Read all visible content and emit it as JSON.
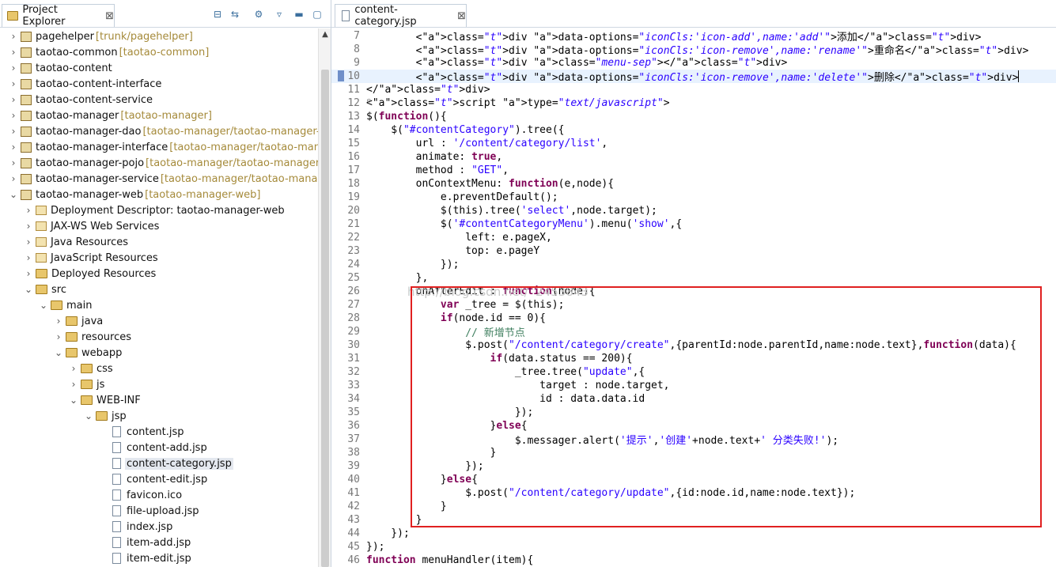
{
  "project_explorer": {
    "title": "Project Explorer",
    "close_glyph": "⊠",
    "toolbar_icons": [
      "collapse-all-icon",
      "link-with-editor-icon",
      "filters-icon",
      "view-menu-icon",
      "minimize-icon",
      "maximize-icon"
    ],
    "items": [
      {
        "label": "pagehelper",
        "decor": " [trunk/pagehelper]",
        "depth": 0,
        "arrow": "›",
        "icon": "project"
      },
      {
        "label": "taotao-common",
        "decor": " [taotao-common]",
        "depth": 0,
        "arrow": "›",
        "icon": "project"
      },
      {
        "label": "taotao-content",
        "decor": "",
        "depth": 0,
        "arrow": "›",
        "icon": "project"
      },
      {
        "label": "taotao-content-interface",
        "decor": "",
        "depth": 0,
        "arrow": "›",
        "icon": "project"
      },
      {
        "label": "taotao-content-service",
        "decor": "",
        "depth": 0,
        "arrow": "›",
        "icon": "project"
      },
      {
        "label": "taotao-manager",
        "decor": " [taotao-manager]",
        "depth": 0,
        "arrow": "›",
        "icon": "project"
      },
      {
        "label": "taotao-manager-dao",
        "decor": " [taotao-manager/taotao-manager-dao",
        "depth": 0,
        "arrow": "›",
        "icon": "project"
      },
      {
        "label": "taotao-manager-interface",
        "decor": " [taotao-manager/taotao-manager",
        "depth": 0,
        "arrow": "›",
        "icon": "project"
      },
      {
        "label": "taotao-manager-pojo",
        "decor": " [taotao-manager/taotao-manager-poj",
        "depth": 0,
        "arrow": "›",
        "icon": "project"
      },
      {
        "label": "taotao-manager-service",
        "decor": " [taotao-manager/taotao-manager-s",
        "depth": 0,
        "arrow": "›",
        "icon": "project"
      },
      {
        "label": "taotao-manager-web",
        "decor": " [taotao-manager-web]",
        "depth": 0,
        "arrow": "⌄",
        "icon": "project"
      },
      {
        "label": "Deployment Descriptor: taotao-manager-web",
        "decor": "",
        "depth": 1,
        "arrow": "›",
        "icon": "pkg"
      },
      {
        "label": "JAX-WS Web Services",
        "decor": "",
        "depth": 1,
        "arrow": "›",
        "icon": "pkg"
      },
      {
        "label": "Java Resources",
        "decor": "",
        "depth": 1,
        "arrow": "›",
        "icon": "pkg"
      },
      {
        "label": "JavaScript Resources",
        "decor": "",
        "depth": 1,
        "arrow": "›",
        "icon": "pkg"
      },
      {
        "label": "Deployed Resources",
        "decor": "",
        "depth": 1,
        "arrow": "›",
        "icon": "folder"
      },
      {
        "label": "src",
        "decor": "",
        "depth": 1,
        "arrow": "⌄",
        "icon": "folder"
      },
      {
        "label": "main",
        "decor": "",
        "depth": 2,
        "arrow": "⌄",
        "icon": "folder"
      },
      {
        "label": "java",
        "decor": "",
        "depth": 3,
        "arrow": "›",
        "icon": "folder"
      },
      {
        "label": "resources",
        "decor": "",
        "depth": 3,
        "arrow": "›",
        "icon": "folder"
      },
      {
        "label": "webapp",
        "decor": "",
        "depth": 3,
        "arrow": "⌄",
        "icon": "folder"
      },
      {
        "label": "css",
        "decor": "",
        "depth": 4,
        "arrow": "›",
        "icon": "folder"
      },
      {
        "label": "js",
        "decor": "",
        "depth": 4,
        "arrow": "›",
        "icon": "folder"
      },
      {
        "label": "WEB-INF",
        "decor": "",
        "depth": 4,
        "arrow": "⌄",
        "icon": "folder"
      },
      {
        "label": "jsp",
        "decor": "",
        "depth": 5,
        "arrow": "⌄",
        "icon": "folder"
      },
      {
        "label": "content.jsp",
        "decor": "",
        "depth": 6,
        "arrow": "",
        "icon": "file"
      },
      {
        "label": "content-add.jsp",
        "decor": "",
        "depth": 6,
        "arrow": "",
        "icon": "file"
      },
      {
        "label": "content-category.jsp",
        "decor": "",
        "depth": 6,
        "arrow": "",
        "icon": "file",
        "selected": true
      },
      {
        "label": "content-edit.jsp",
        "decor": "",
        "depth": 6,
        "arrow": "",
        "icon": "file"
      },
      {
        "label": "favicon.ico",
        "decor": "",
        "depth": 6,
        "arrow": "",
        "icon": "file"
      },
      {
        "label": "file-upload.jsp",
        "decor": "",
        "depth": 6,
        "arrow": "",
        "icon": "file"
      },
      {
        "label": "index.jsp",
        "decor": "",
        "depth": 6,
        "arrow": "",
        "icon": "file"
      },
      {
        "label": "item-add.jsp",
        "decor": "",
        "depth": 6,
        "arrow": "",
        "icon": "file"
      },
      {
        "label": "item-edit.jsp",
        "decor": "",
        "depth": 6,
        "arrow": "",
        "icon": "file"
      }
    ]
  },
  "editor": {
    "tab_title": "content-category.jsp",
    "close_glyph": "⊠",
    "current_line": "10",
    "watermark": "http://blog.csdn.net/  2453843",
    "lines": [
      {
        "n": "7",
        "code": "        <div data-options=\"iconCls:'icon-add',name:'add'\">添加</div>"
      },
      {
        "n": "8",
        "code": "        <div data-options=\"iconCls:'icon-remove',name:'rename'\">重命名</div>"
      },
      {
        "n": "9",
        "code": "        <div class=\"menu-sep\"></div>"
      },
      {
        "n": "10",
        "code": "        <div data-options=\"iconCls:'icon-remove',name:'delete'\">删除</div>"
      },
      {
        "n": "11",
        "code": "</div>"
      },
      {
        "n": "12",
        "code": "<script type=\"text/javascript\">",
        "fold": "⊖"
      },
      {
        "n": "13",
        "code": "$(function(){"
      },
      {
        "n": "14",
        "code": "    $(\"#contentCategory\").tree({"
      },
      {
        "n": "15",
        "code": "        url : '/content/category/list',"
      },
      {
        "n": "16",
        "code": "        animate: true,"
      },
      {
        "n": "17",
        "code": "        method : \"GET\","
      },
      {
        "n": "18",
        "code": "        onContextMenu: function(e,node){"
      },
      {
        "n": "19",
        "code": "            e.preventDefault();"
      },
      {
        "n": "20",
        "code": "            $(this).tree('select',node.target);"
      },
      {
        "n": "21",
        "code": "            $('#contentCategoryMenu').menu('show',{"
      },
      {
        "n": "22",
        "code": "                left: e.pageX,"
      },
      {
        "n": "23",
        "code": "                top: e.pageY"
      },
      {
        "n": "24",
        "code": "            });"
      },
      {
        "n": "25",
        "code": "        },"
      },
      {
        "n": "26",
        "code": "        onAfterEdit : function(node){"
      },
      {
        "n": "27",
        "code": "            var _tree = $(this);"
      },
      {
        "n": "28",
        "code": "            if(node.id == 0){"
      },
      {
        "n": "29",
        "code": "                // 新增节点"
      },
      {
        "n": "30",
        "code": "                $.post(\"/content/category/create\",{parentId:node.parentId,name:node.text},function(data){"
      },
      {
        "n": "31",
        "code": "                    if(data.status == 200){"
      },
      {
        "n": "32",
        "code": "                        _tree.tree(\"update\",{"
      },
      {
        "n": "33",
        "code": "                            target : node.target,"
      },
      {
        "n": "34",
        "code": "                            id : data.data.id"
      },
      {
        "n": "35",
        "code": "                        });"
      },
      {
        "n": "36",
        "code": "                    }else{"
      },
      {
        "n": "37",
        "code": "                        $.messager.alert('提示','创建'+node.text+' 分类失败!');"
      },
      {
        "n": "38",
        "code": "                    }"
      },
      {
        "n": "39",
        "code": "                });"
      },
      {
        "n": "40",
        "code": "            }else{"
      },
      {
        "n": "41",
        "code": "                $.post(\"/content/category/update\",{id:node.id,name:node.text});"
      },
      {
        "n": "42",
        "code": "            }"
      },
      {
        "n": "43",
        "code": "        }"
      },
      {
        "n": "44",
        "code": "    });"
      },
      {
        "n": "45",
        "code": "});"
      },
      {
        "n": "46",
        "code": "function menuHandler(item){"
      }
    ]
  }
}
